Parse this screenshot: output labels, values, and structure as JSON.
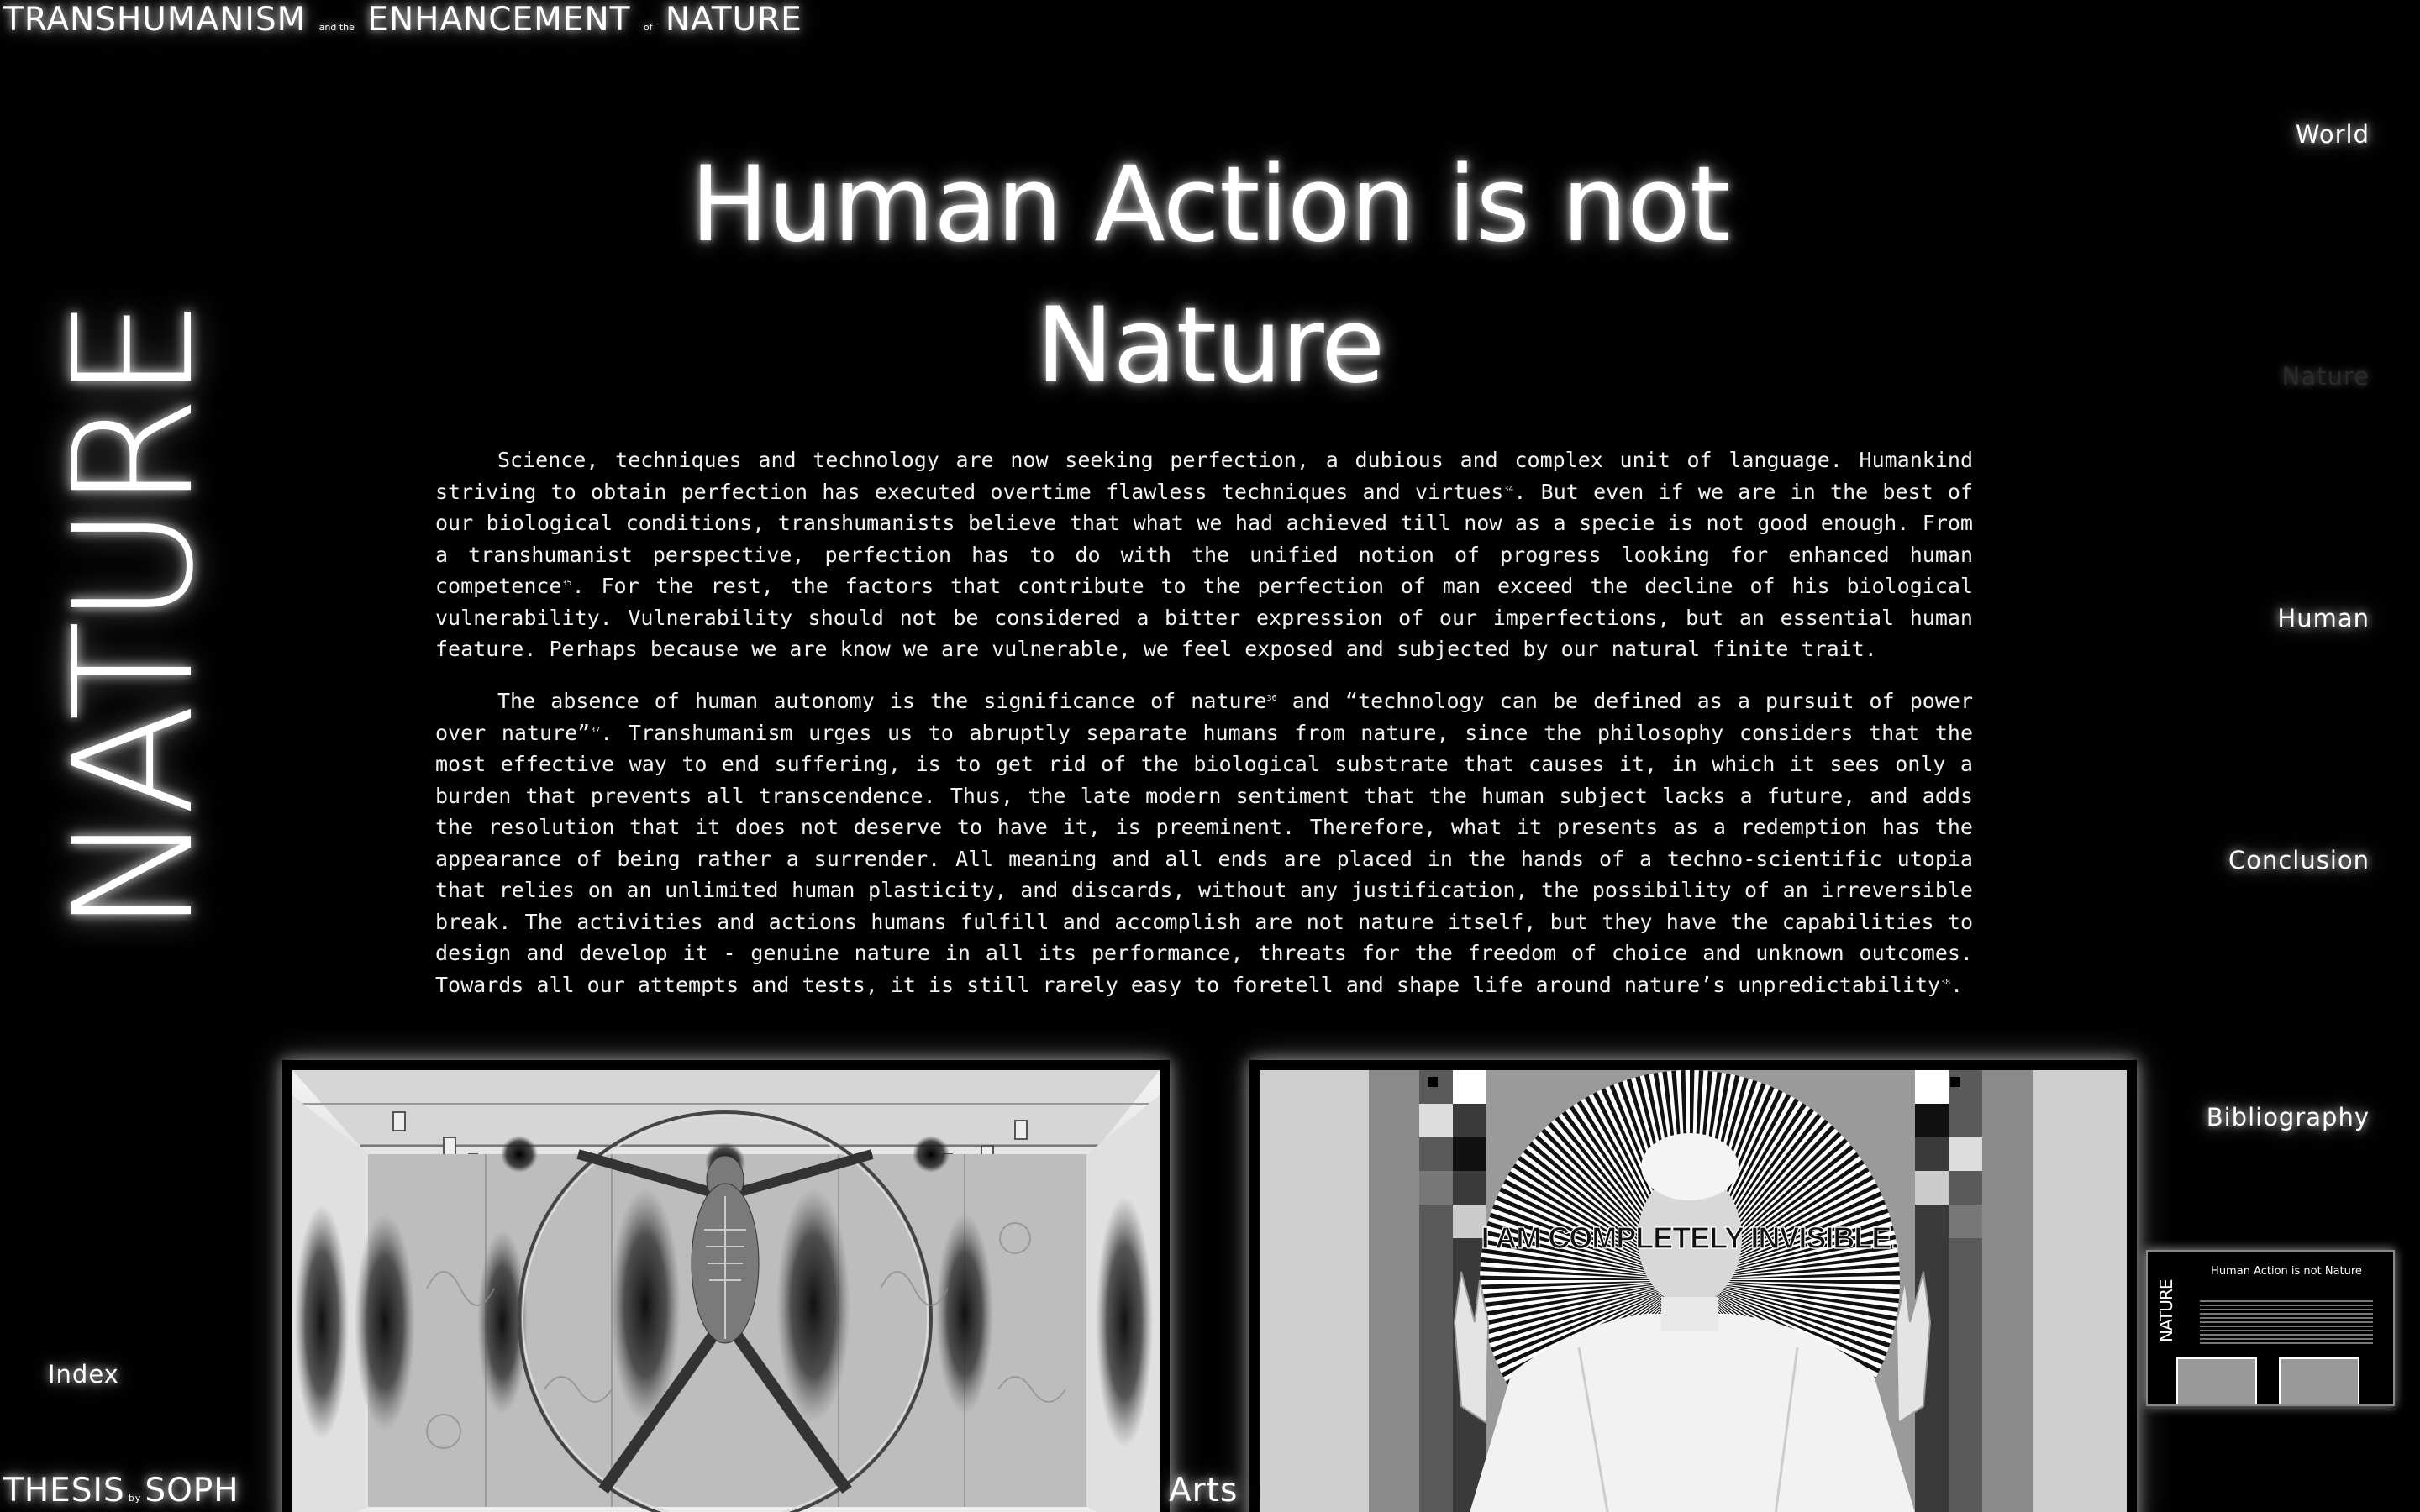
{
  "header": {
    "title_word_1": "TRANSHUMANISM",
    "title_small_1": "and the",
    "title_word_2": "ENHANCEMENT",
    "title_small_2": "of",
    "title_word_3": "NATURE"
  },
  "section_word": "NATURE",
  "main": {
    "title": "Human Action is not Nature",
    "paragraph_1": {
      "part_a": "Science, techniques and technology are now seeking perfection, a dubious and complex unit of language. Humankind striving to obtain perfection has executed overtime flawless techniques and virtues",
      "note_a": "34",
      "part_b": ". But even if we are in the best of our biological conditions, transhumanists believe that what we had achieved till now as a specie is not good enough. From a transhumanist perspective, perfection has to do with the unified notion of progress looking for enhanced human competence",
      "note_b": "35",
      "part_c": ". For the rest, the factors that contribute to the perfection of man exceed the decline of his biological vulnerability. Vulnerability should not be considered a bitter expression of our imperfections, but an essential human feature. Perhaps because we are know we are vulnerable, we feel exposed and subjected by our natural finite trait."
    },
    "paragraph_2": {
      "part_a": "The absence of human autonomy is the significance of nature",
      "note_a": "36",
      "part_b": " and “technology can be defined as a pursuit of power over nature”",
      "note_b": "37",
      "part_c": ". Transhumanism urges us to abruptly separate humans from nature, since the philosophy considers that the most effective way to end suffering, is to get rid of the biological substrate that causes it, in which it sees only a burden that prevents all transcendence. Thus, the late modern sentiment that the human subject lacks a future, and adds the resolution that it does not deserve to have it, is preeminent. Therefore, what it presents as a redemption has the appearance of being rather a surrender. All meaning and all ends are placed in the hands of a techno-scientific utopia that relies on an unlimited human plasticity, and discards, without any justification, the possibility of an irreversible break. The activities and actions humans fulfill and accomplish are not nature itself, but they have the capabilities to design and develop it - genuine nature in all its performance, threats for the freedom of choice and unknown outcomes. Towards all our attempts and tests, it is still rarely easy to foretell and shape life around nature’s unpredictability",
      "note_c": "38",
      "part_d": "."
    }
  },
  "nav": {
    "items": [
      {
        "label": "World"
      },
      {
        "label": "Nature"
      },
      {
        "label": "Human"
      },
      {
        "label": "Conclusion"
      },
      {
        "label": "Bibliography"
      }
    ],
    "active": "Nature"
  },
  "footer": {
    "index_label": "Index",
    "thesis_word": "THESIS",
    "thesis_small": "by",
    "author_partial": "SOPH",
    "arts_partial": "Arts"
  },
  "images": {
    "right_caption": "I AM COMPLETELY INVISIBLE."
  },
  "minimap": {
    "side_word": "NATURE",
    "title": "Human Action is not Nature"
  },
  "colors": {
    "background": "#000000",
    "text": "#ffffff",
    "glow": "#ffffff",
    "inactive_nav": "#2a2a2a"
  }
}
